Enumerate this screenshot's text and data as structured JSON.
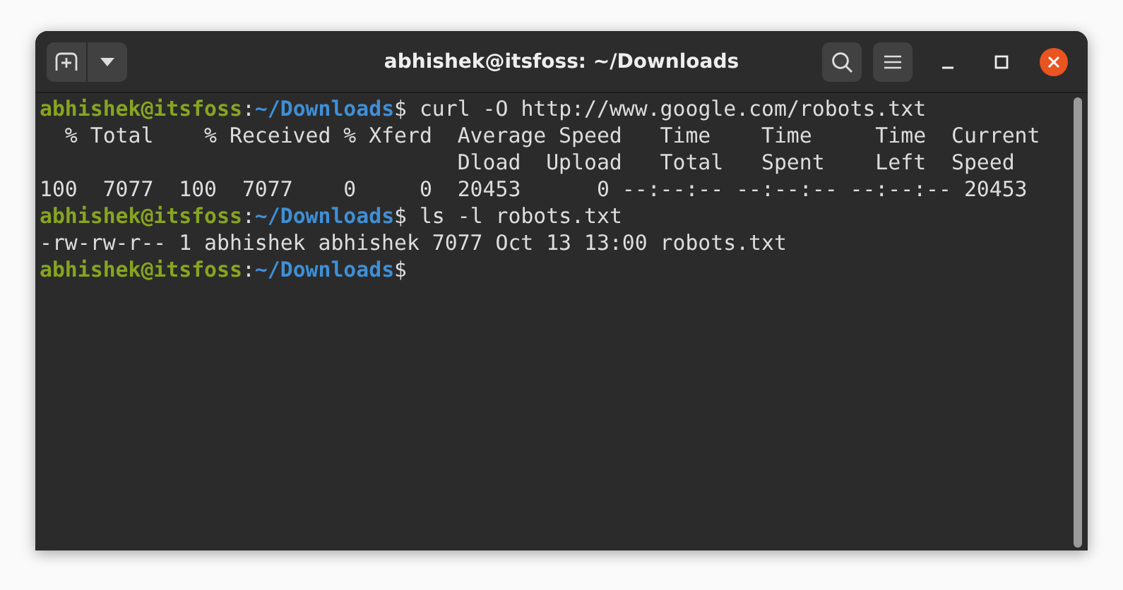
{
  "window": {
    "title": "abhishek@itsfoss: ~/Downloads"
  },
  "terminal": {
    "lines": [
      {
        "kind": "prompt",
        "user": "abhishek@itsfoss",
        "separator": ":",
        "path": "~/Downloads",
        "symbol": "$",
        "command": "curl -O http://www.google.com/robots.txt"
      },
      {
        "kind": "output",
        "text": "  % Total    % Received % Xferd  Average Speed   Time    Time     Time  Current"
      },
      {
        "kind": "output",
        "text": "                                 Dload  Upload   Total   Spent    Left  Speed"
      },
      {
        "kind": "output",
        "text": "100  7077  100  7077    0     0  20453      0 --:--:-- --:--:-- --:--:-- 20453"
      },
      {
        "kind": "prompt",
        "user": "abhishek@itsfoss",
        "separator": ":",
        "path": "~/Downloads",
        "symbol": "$",
        "command": "ls -l robots.txt"
      },
      {
        "kind": "output",
        "text": "-rw-rw-r-- 1 abhishek abhishek 7077 Oct 13 13:00 robots.txt"
      },
      {
        "kind": "prompt",
        "user": "abhishek@itsfoss",
        "separator": ":",
        "path": "~/Downloads",
        "symbol": "$"
      }
    ]
  }
}
